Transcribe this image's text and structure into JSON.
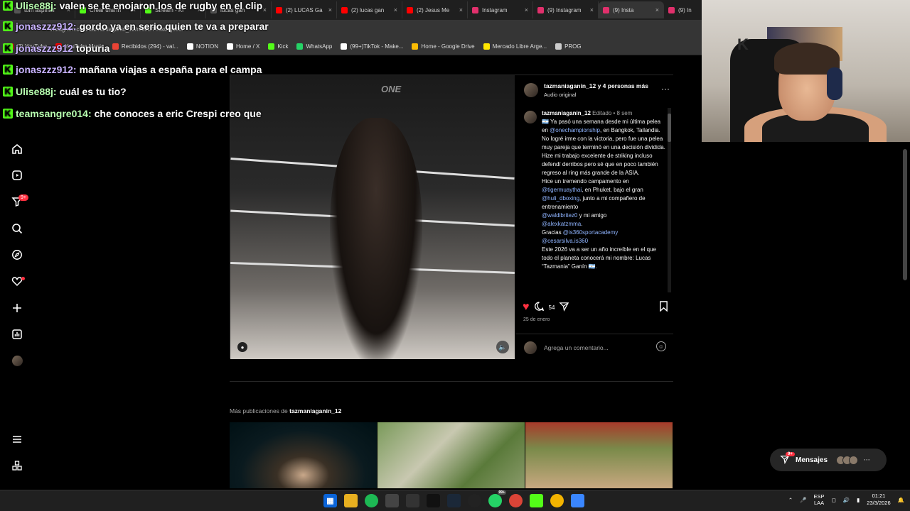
{
  "browser": {
    "tabs": [
      {
        "label": "tom aspinall",
        "color": "#555555"
      },
      {
        "label": "Crear una in",
        "color": "#53fc18"
      },
      {
        "label": "Stream - Ki",
        "color": "#53fc18"
      },
      {
        "label": "lucas gan",
        "color": "#555555"
      },
      {
        "label": "(2) LUCAS Ga",
        "color": "#ff0000"
      },
      {
        "label": "(2) lucas gan",
        "color": "#ff0000"
      },
      {
        "label": "(2) Jesus Me",
        "color": "#ff0000"
      },
      {
        "label": "Instagram",
        "color": "#e1306c"
      },
      {
        "label": "(9) Instagram",
        "color": "#e1306c"
      },
      {
        "label": "(9) Insta",
        "color": "#e1306c"
      },
      {
        "label": "(9) In",
        "color": "#e1306c"
      }
    ],
    "url": "instagram.com/tazmaniaganin_12/reel/DTnvk0rgo8o/",
    "bookmarks": [
      {
        "label": "(3) YouTube",
        "color": "#ff0000"
      },
      {
        "label": "YouTube Music",
        "color": "#ff0000"
      },
      {
        "label": "Recibidos (294) - val...",
        "color": "#ea4335"
      },
      {
        "label": "NOTION",
        "color": "#ffffff"
      },
      {
        "label": "Home / X",
        "color": "#ffffff"
      },
      {
        "label": "Kick",
        "color": "#53fc18"
      },
      {
        "label": "WhatsApp",
        "color": "#25d366"
      },
      {
        "label": "(99+)TikTok - Make...",
        "color": "#ffffff"
      },
      {
        "label": "Home - Google Drive",
        "color": "#fbbc04"
      },
      {
        "label": "Mercado Libre Arge...",
        "color": "#ffe600"
      },
      {
        "label": "PROG",
        "color": "#cccccc"
      }
    ]
  },
  "chat": [
    {
      "user": "Ulise88j:",
      "msg": "valen se te enojaron los de rugby en el clip",
      "color": "#b8ffb0"
    },
    {
      "user": "jonaszzz912:",
      "msg": "gordo ya en serio quien te va a preparar",
      "color": "#c9b3ff"
    },
    {
      "user": "jonaszzz912",
      "msg": "topuria",
      "color": "#c9b3ff"
    },
    {
      "user": "jonaszzz912:",
      "msg": "mañana viajas a españa para el campa",
      "color": "#c9b3ff"
    },
    {
      "user": "Ulise88j:",
      "msg": "cuál es tu tio?",
      "color": "#b8ffb0"
    },
    {
      "user": "teamsangre014:",
      "msg": "che conoces a eric Crespi creo que",
      "color": "#b8ffb0"
    }
  ],
  "sidebar": {
    "badge": "9+",
    "items": [
      "home-icon",
      "reels-icon",
      "filter-icon",
      "search-icon",
      "explore-icon",
      "notifications-icon",
      "create-icon",
      "dashboard-icon",
      "profile-icon"
    ],
    "bottom": [
      "menu-icon",
      "apps-icon"
    ]
  },
  "post": {
    "video_logo": "ONE",
    "header_user": "tazmaniaganin_12 y 4 personas más",
    "header_audio": "Audio original",
    "caption_user": "tazmaniaganin_12",
    "caption_meta": "Editado • 8 sem",
    "caption_parts": {
      "p1": "🇦🇷 Ya pasó una semana desde mi última pelea en ",
      "m1": "@onechampionship",
      "p2": ", en Bangkok, Tailandia.",
      "p3": "No logré irme con la victoria, pero fue una pelea muy pareja que terminó en una decisión dividida. Hize mi trabajo excelente de striking incluso defendí derribos pero sé que en poco también regreso al ring más grande de la ASIA.",
      "p4": "Hice un tremendo campamento en",
      "m2": "@tigermuaythai",
      "p5": ", en Phuket, bajo el gran ",
      "m3": "@huli_dboxing",
      "p6": ", junto a mi compañero de entrenamiento",
      "m4": "@waldibritez0",
      "p7": " y mi amigo",
      "m5": "@alexkatzmma",
      "p8": ".",
      "p9": "Gracias ",
      "m6": "@is360sportacademy",
      "m7": "@cesarsilva.is360",
      "p10": "Este 2026 va a ser un año increíble en el que todo el planeta conocerá mi nombre: Lucas “Tazmania” Ganín 🇦🇷."
    },
    "comments_count": "54",
    "date": "25 de enero",
    "comment_placeholder": "Agrega un comentario..."
  },
  "more": {
    "prefix": "Más publicaciones de ",
    "user": "tazmaniaganin_12"
  },
  "messages": {
    "label": "Mensajes",
    "badge": "9+"
  },
  "taskbar": {
    "whatsapp_badge": "99+",
    "lang1": "ESP",
    "lang2": "LAA",
    "time": "01:21",
    "date": "23/3/2026"
  }
}
